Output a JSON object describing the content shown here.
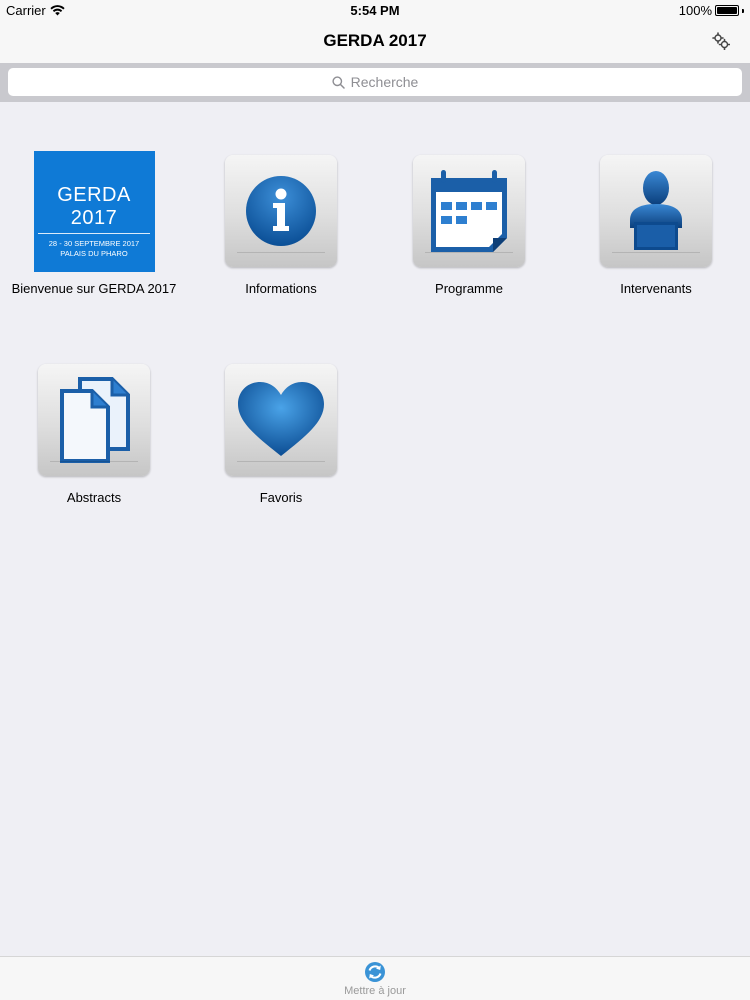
{
  "status_bar": {
    "carrier": "Carrier",
    "time": "5:54 PM",
    "battery": "100%"
  },
  "nav": {
    "title": "GERDA 2017",
    "settings_icon": "gears-icon"
  },
  "search": {
    "placeholder": "Recherche"
  },
  "tiles": [
    {
      "label": "Bienvenue sur GERDA 2017",
      "banner": {
        "title": "GERDA 2017",
        "dates": "28 - 30 SEPTEMBRE 2017",
        "venue": "PALAIS DU PHARO",
        "color": "#0f7ad6"
      }
    },
    {
      "label": "Informations",
      "icon": "info-icon"
    },
    {
      "label": "Programme",
      "icon": "calendar-icon"
    },
    {
      "label": "Intervenants",
      "icon": "speaker-icon"
    },
    {
      "label": "Abstracts",
      "icon": "documents-icon"
    },
    {
      "label": "Favoris",
      "icon": "heart-icon"
    }
  ],
  "toolbar": {
    "update_label": "Mettre à jour",
    "update_icon": "refresh-icon"
  },
  "colors": {
    "accent_blue": "#1b6fc0",
    "banner_blue": "#0f7ad6",
    "background": "#efeff4"
  }
}
